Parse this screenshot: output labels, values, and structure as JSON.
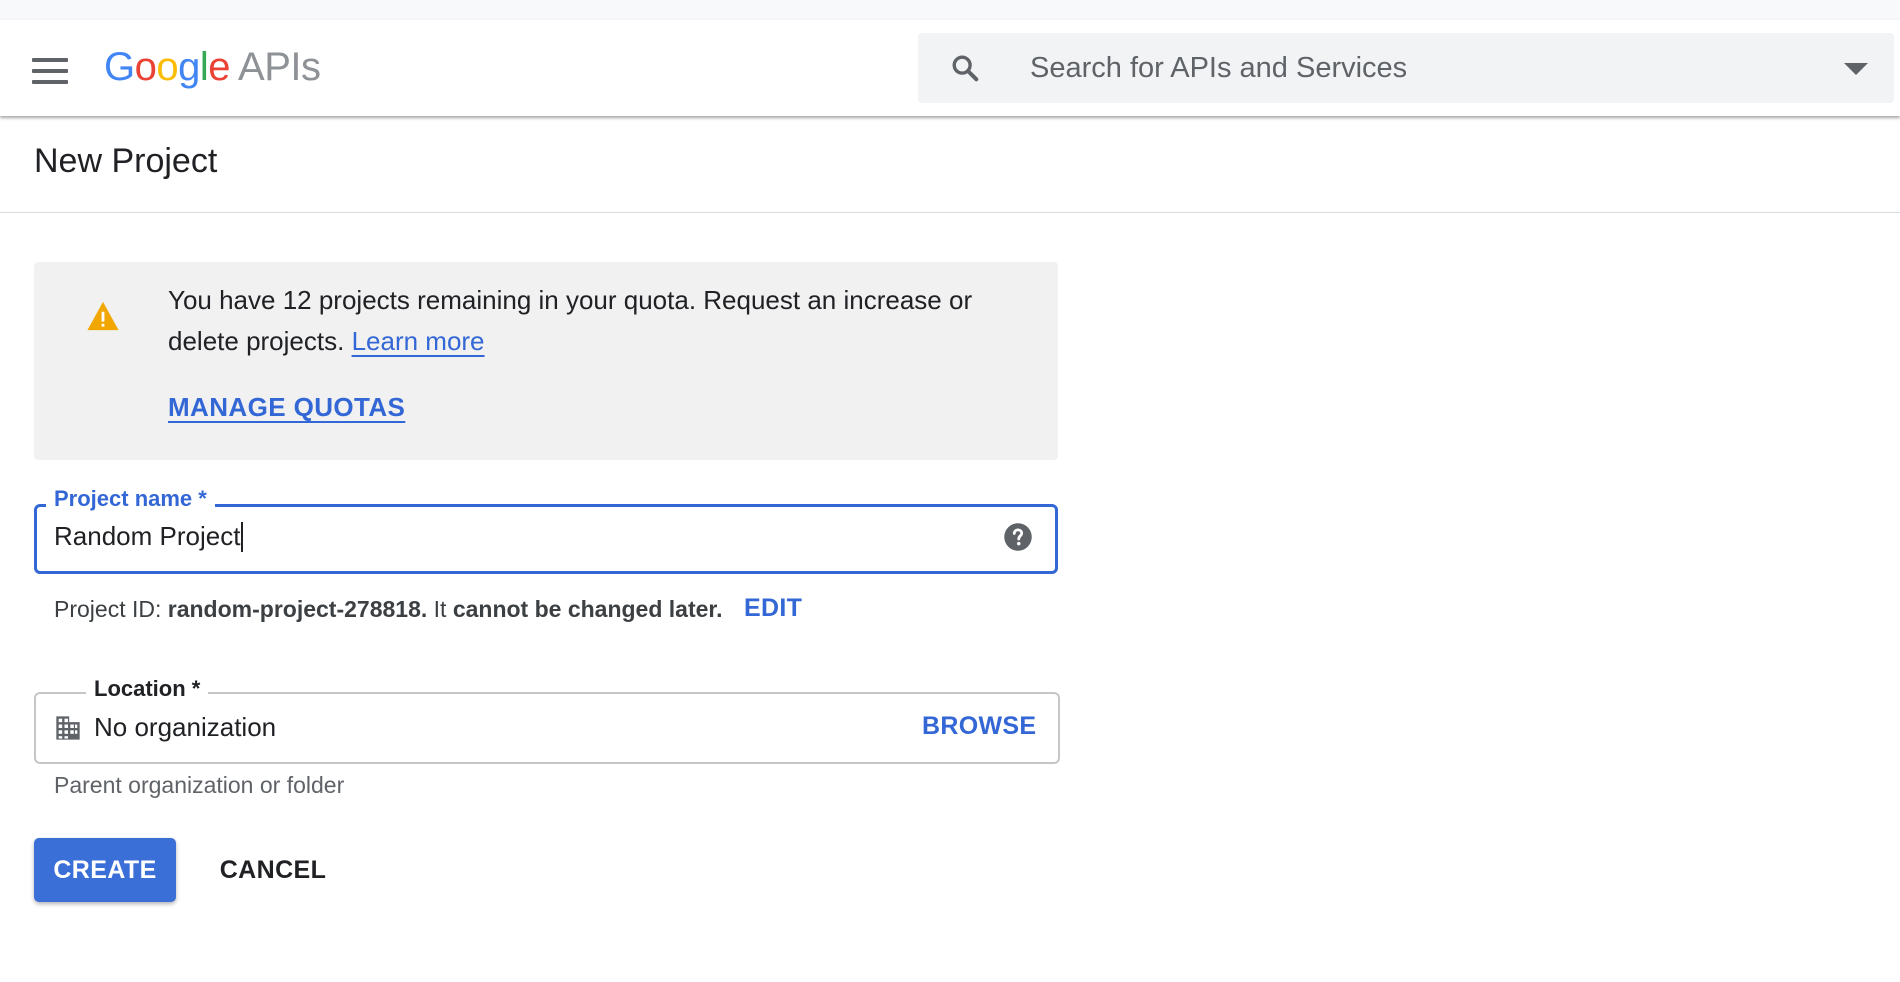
{
  "header": {
    "logo": {
      "g1": "G",
      "o1": "o",
      "o2": "o",
      "g2": "g",
      "l": "l",
      "e": "e",
      "suffix": "APIs"
    },
    "search": {
      "placeholder": "Search for APIs and Services",
      "icon": "search-icon",
      "dropdown_icon": "caret-down-icon"
    },
    "menu_icon": "hamburger-menu-icon"
  },
  "page": {
    "title": "New Project"
  },
  "quota": {
    "icon": "warning-icon",
    "message": "You have 12 projects remaining in your quota. Request an increase or delete projects.",
    "learn_more": "Learn more",
    "manage_quotas": "MANAGE QUOTAS"
  },
  "project_name": {
    "label": "Project name *",
    "value": "Random Project",
    "help_icon": "help-icon"
  },
  "project_id": {
    "prefix": "Project ID: ",
    "id": "random-project-278818.",
    "middle": " It ",
    "note": "cannot be changed later.",
    "edit": "EDIT"
  },
  "location": {
    "label": "Location *",
    "value": "No organization",
    "browse": "BROWSE",
    "hint": "Parent organization or folder",
    "icon": "organization-icon"
  },
  "actions": {
    "create": "CREATE",
    "cancel": "CANCEL"
  },
  "colors": {
    "accent": "#3367d6",
    "primary_button": "#3b6fd8",
    "warning": "#f2a600",
    "google_blue": "#4285f4",
    "google_red": "#ea4335",
    "google_yellow": "#fbbc05",
    "google_green": "#34a853"
  }
}
